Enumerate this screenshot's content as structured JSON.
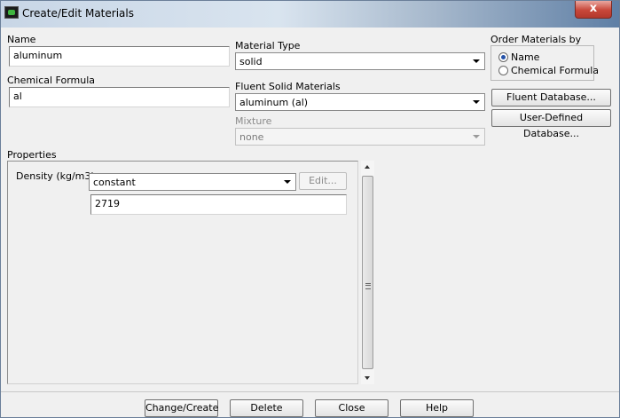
{
  "window": {
    "title": "Create/Edit Materials",
    "close_glyph": "x"
  },
  "name": {
    "label": "Name",
    "value": "aluminum"
  },
  "chemical_formula": {
    "label": "Chemical Formula",
    "value": "al"
  },
  "material_type": {
    "label": "Material Type",
    "value": "solid"
  },
  "fluent_solid_materials": {
    "label": "Fluent Solid Materials",
    "value": "aluminum (al)"
  },
  "mixture": {
    "label": "Mixture",
    "value": "none"
  },
  "order_by": {
    "label": "Order Materials by",
    "options": [
      {
        "label": "Name",
        "checked": true
      },
      {
        "label": "Chemical Formula",
        "checked": false
      }
    ]
  },
  "database_buttons": {
    "fluent": "Fluent Database...",
    "user_defined": "User-Defined Database..."
  },
  "properties": {
    "label": "Properties",
    "density": {
      "label": "Density (kg/m3)",
      "method": "constant",
      "edit_label": "Edit...",
      "value": "2719"
    }
  },
  "footer": {
    "change_create": "Change/Create",
    "delete": "Delete",
    "close": "Close",
    "help": "Help"
  },
  "icons": {
    "scroll_grip": "grip-icon"
  }
}
